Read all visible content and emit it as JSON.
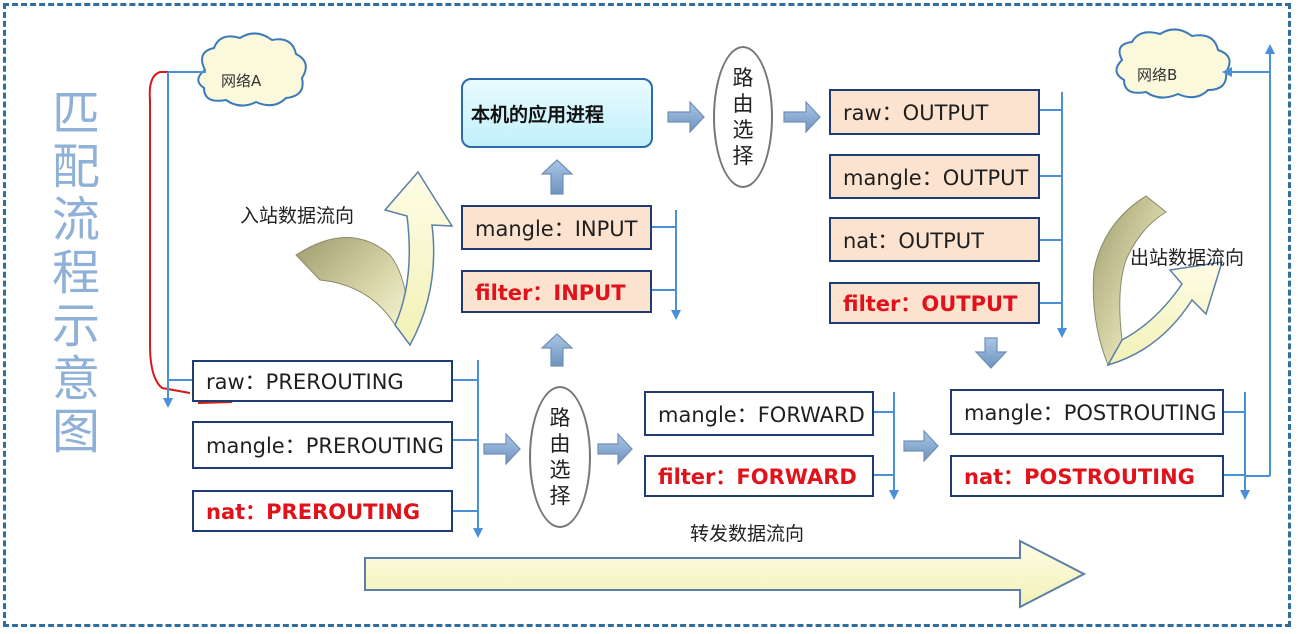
{
  "title": "匹配流程示意图",
  "clouds": {
    "network_a": "网络A",
    "network_b": "网络B"
  },
  "process": "本机的应用进程",
  "routing": "路由选择",
  "prerouting": [
    "raw：PREROUTING",
    "mangle：PREROUTING",
    "nat：PREROUTING"
  ],
  "input": [
    "mangle：INPUT",
    "filter：INPUT"
  ],
  "output": [
    "raw：OUTPUT",
    "mangle：OUTPUT",
    "nat：OUTPUT",
    "filter：OUTPUT"
  ],
  "forward": [
    "mangle：FORWARD",
    "filter：FORWARD"
  ],
  "postrouting": [
    "mangle：POSTROUTING",
    "nat：POSTROUTING"
  ],
  "flows": {
    "inbound": "入站数据流向",
    "outbound": "出站数据流向",
    "forward": "转发数据流向"
  },
  "colors": {
    "frame": "#2f6e9e",
    "box_border": "#1f3b73",
    "peach": "#fbe3cf",
    "red_text": "#e0121b",
    "line_blue": "#4a90d9",
    "title": "#8fb1d8"
  }
}
